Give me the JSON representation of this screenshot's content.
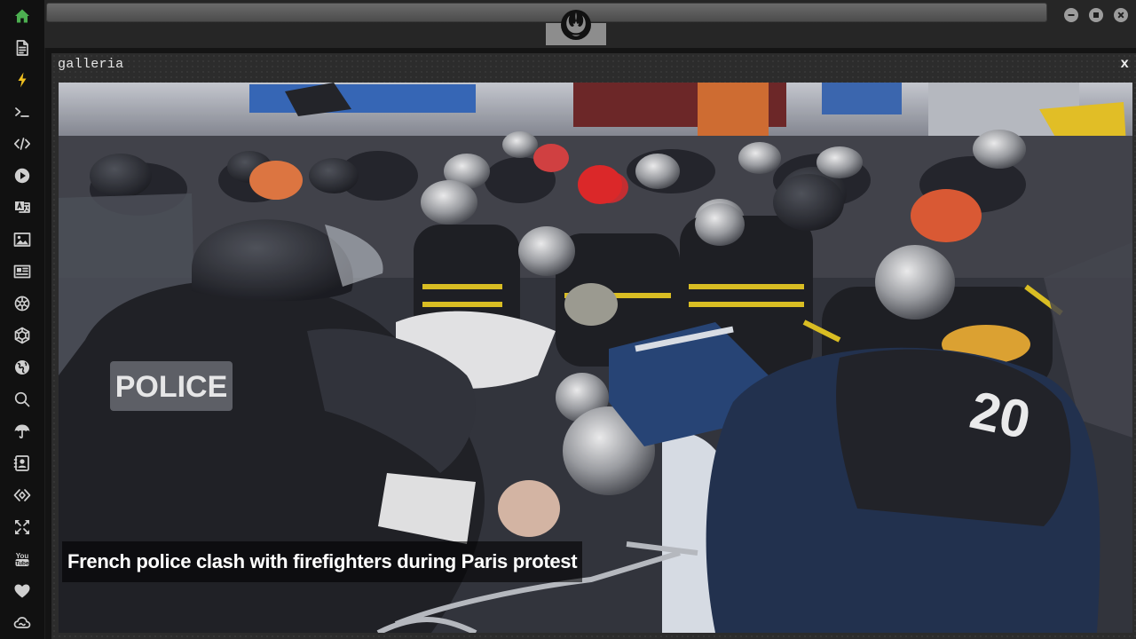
{
  "window": {
    "buttons": [
      "minimize",
      "maximize",
      "close"
    ]
  },
  "sidebar": {
    "items": [
      {
        "icon": "home-icon",
        "color": "#4caf50"
      },
      {
        "icon": "document-icon"
      },
      {
        "icon": "lightning-icon",
        "color": "#f0c020"
      },
      {
        "icon": "terminal-icon"
      },
      {
        "icon": "code-icon"
      },
      {
        "icon": "play-icon"
      },
      {
        "icon": "translate-icon"
      },
      {
        "icon": "image-icon"
      },
      {
        "icon": "newspaper-icon"
      },
      {
        "icon": "settings-icon"
      },
      {
        "icon": "hexagon-icon"
      },
      {
        "icon": "globe-icon"
      },
      {
        "icon": "search-icon"
      },
      {
        "icon": "umbrella-icon"
      },
      {
        "icon": "contact-icon"
      },
      {
        "icon": "embed-icon"
      },
      {
        "icon": "expand-icon"
      },
      {
        "icon": "youtube-icon"
      },
      {
        "icon": "heart-icon"
      },
      {
        "icon": "cloud-icon"
      }
    ]
  },
  "topbar": {
    "logo": "rebel-alliance-icon"
  },
  "panel": {
    "title": "galleria",
    "close_label": "x",
    "image_alt": "Photo of police in riot gear clashing with firefighters in helmets during a street protest",
    "caption": "French police clash with firefighters during Paris protest"
  },
  "colors": {
    "accent_home": "#4caf50",
    "accent_bolt": "#f0c020",
    "sidebar_bg": "#111111",
    "panel_bg": "#2c2c2c"
  }
}
